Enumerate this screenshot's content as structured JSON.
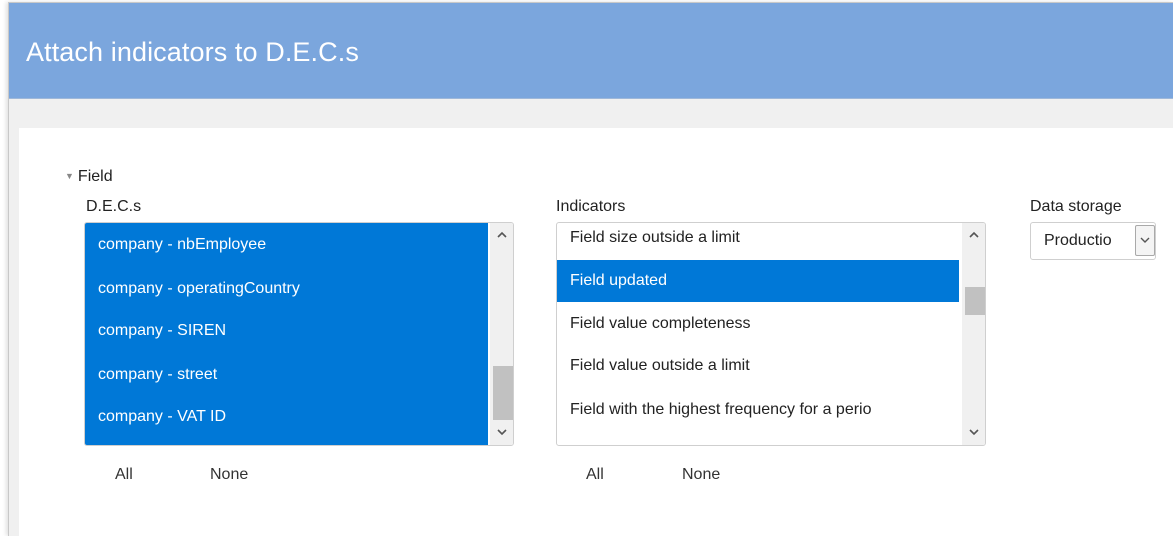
{
  "dialog": {
    "title": "Attach indicators to D.E.C.s"
  },
  "section": {
    "label": "Field",
    "toggle_icon": "triangle-down-icon"
  },
  "decs": {
    "label": "D.E.C.s",
    "items": [
      {
        "label": "company - nbEmployee",
        "selected": true
      },
      {
        "label": "company - operatingCountry",
        "selected": true
      },
      {
        "label": "company - SIREN",
        "selected": true
      },
      {
        "label": "company - street",
        "selected": true
      },
      {
        "label": "company - VAT ID",
        "selected": true
      }
    ],
    "all_label": "All",
    "none_label": "None"
  },
  "indicators": {
    "label": "Indicators",
    "items": [
      {
        "label": "Field size outside a limit",
        "selected": false
      },
      {
        "label": "Field updated",
        "selected": true
      },
      {
        "label": "Field value completeness",
        "selected": false
      },
      {
        "label": "Field value outside a limit",
        "selected": false
      },
      {
        "label": "Field with the highest frequency for a perio",
        "selected": false
      }
    ],
    "all_label": "All",
    "none_label": "None"
  },
  "data_storage": {
    "label": "Data storage",
    "selected_value": "Productio",
    "arrow_icon": "chevron-down-icon"
  },
  "colors": {
    "title_bar": "#7ba6dd",
    "selection": "#0078d7",
    "dialog_bg": "#f0f0f0"
  }
}
